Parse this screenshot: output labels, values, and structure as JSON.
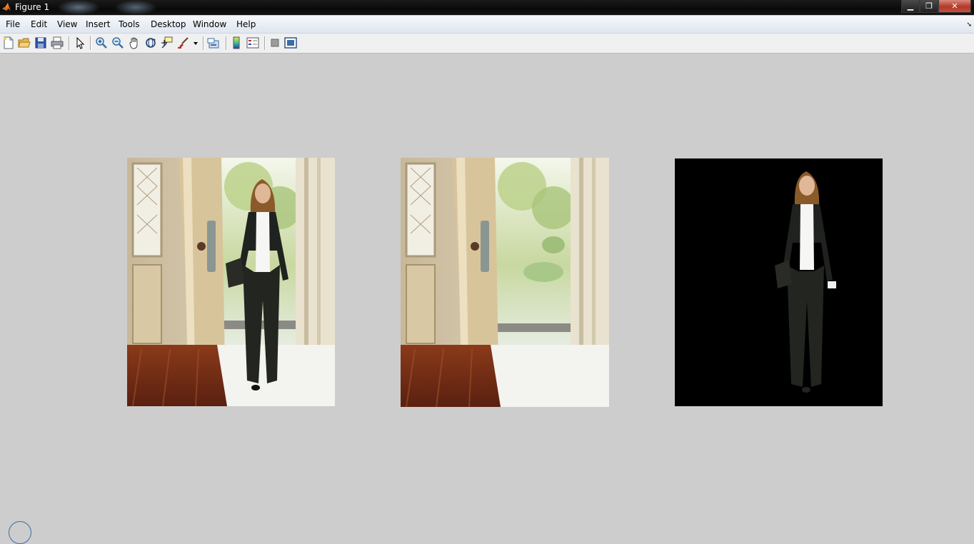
{
  "window": {
    "title": "Figure 1",
    "minimize_glyph": "▁",
    "maximize_glyph": "❐",
    "close_glyph": "✕"
  },
  "menu": [
    "File",
    "Edit",
    "View",
    "Insert",
    "Tools",
    "Desktop",
    "Window",
    "Help"
  ],
  "menu_overflow_glyph": "➘",
  "toolbar": [
    "new-figure-icon",
    "open-file-icon",
    "save-figure-icon",
    "print-figure-icon",
    "edit-plot-arrow-icon",
    "zoom-in-icon",
    "zoom-out-icon",
    "pan-hand-icon",
    "rotate-3d-icon",
    "data-cursor-icon",
    "brush-icon",
    "brush-dropdown-arrow-icon",
    "link-plot-icon",
    "insert-colorbar-icon",
    "insert-legend-icon",
    "hide-plot-tools-icon",
    "show-plot-tools-icon"
  ],
  "axes": [
    {
      "content": "original photo: woman in dark suit walking through open door"
    },
    {
      "content": "background photo: open door without person"
    },
    {
      "content": "segmented foreground: woman on black background"
    }
  ],
  "colors": {
    "figure_bg": "#cdcdcd",
    "title_bar": "#111111",
    "close_button": "#c0442f",
    "menu_bar": "#e7edf5",
    "toolbar": "#f0f0f0"
  }
}
